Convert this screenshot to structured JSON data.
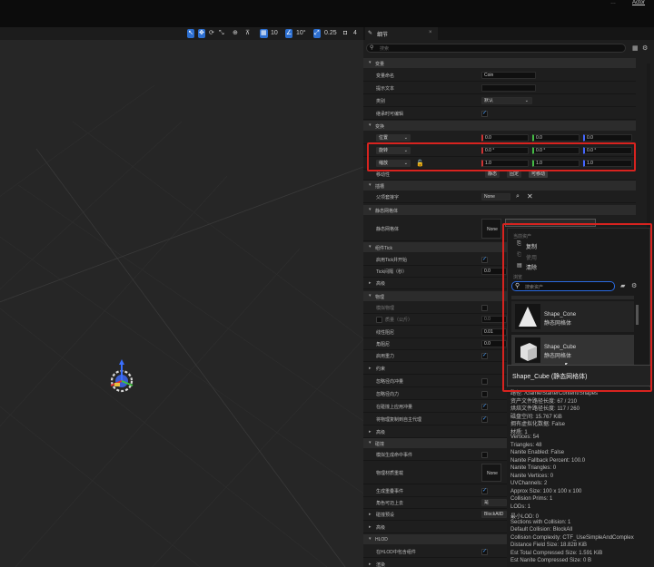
{
  "topbar": {
    "right_text1": "…",
    "right_text2": "Actor"
  },
  "viewport": {
    "toolbar": {
      "grid": "10",
      "angle": "10°",
      "scale": "0.25",
      "cams": "4"
    }
  },
  "panel": {
    "tab": "细节",
    "search_placeholder": "搜索",
    "sections": {
      "variable": "变量",
      "transform": "变换",
      "socket": "插槽",
      "static_mesh": "静态网格体",
      "component_tick": "组件Tick",
      "advanced": "高级",
      "physics": "物理",
      "constraints": "约束",
      "collision": "碰撞",
      "hlod": "HLOD",
      "rendering": "渲染"
    },
    "rows": {
      "var_name": {
        "label": "变量命名",
        "value": "Coin"
      },
      "tooltip": {
        "label": "提示文本",
        "value": ""
      },
      "category": {
        "label": "类别",
        "value": "默认"
      },
      "editable": {
        "label": "继承时可编辑"
      },
      "location": {
        "label": "位置",
        "x": "0.0",
        "y": "0.0",
        "z": "0.0"
      },
      "rotation": {
        "label": "旋转",
        "x": "0.0 °",
        "y": "0.0 °",
        "z": "0.0 °"
      },
      "scale": {
        "label": "缩放",
        "x": "1.0",
        "y": "1.0",
        "z": "1.0"
      },
      "mobility": {
        "label": "移动性",
        "options": [
          "静态",
          "固定",
          "可移动"
        ]
      },
      "parent_socket": {
        "label": "父项套接字",
        "value": "None"
      },
      "static_mesh": {
        "label": "静态网格体",
        "value": "None"
      },
      "tick_start": {
        "label": "启用Tick并开始"
      },
      "tick_interval": {
        "label": "Tick间隔（秒）",
        "value": "0.0"
      },
      "simulate": {
        "label": "模拟物理"
      },
      "mass": {
        "label": "质量（公斤）",
        "value": "0.0"
      },
      "linear_damp": {
        "label": "线性阻尼",
        "value": "0.01"
      },
      "angular_damp": {
        "label": "角阻尼",
        "value": "0.0"
      },
      "gravity": {
        "label": "启用重力"
      },
      "ignore_radial_impulse": {
        "label": "忽略径向冲量"
      },
      "ignore_radial_force": {
        "label": "忽略径向力"
      },
      "apply_impulse": {
        "label": "在碰撞上应用冲量"
      },
      "replicate": {
        "label": "将物理复制到自主代理"
      },
      "overlap_events": {
        "label": "模拟生成命中事件"
      },
      "phys_material": {
        "label": "物理材质重载",
        "value": "None"
      },
      "gen_overlap": {
        "label": "生成重叠事件"
      },
      "char_step": {
        "label": "角色可迈上去",
        "value": "是"
      },
      "collision_preset": {
        "label": "碰撞预设",
        "value": "BlockAllD"
      },
      "hlod_include": {
        "label": "在HLOD中包含组件"
      }
    }
  },
  "popup": {
    "section_current": "当前资产",
    "copy": "复制",
    "use": "使用",
    "clear": "清除",
    "section_browse": "浏览",
    "search_placeholder": "搜索资产",
    "items": [
      {
        "name": "Shape_Cone",
        "type": "静态网格体"
      },
      {
        "name": "Shape_Cube",
        "type": "静态网格体"
      }
    ],
    "tooltip_title": "Shape_Cube (静态网格体)",
    "details": [
      "路径: /Game/StarterContent/Shapes",
      "资产文件路径长度: 67 / 210",
      "烘焙文件路径长度: 117 / 260",
      "磁盘空间: 15.767 KiB",
      "拥有虚拟化数据: False",
      "材质: 1",
      "Vertices: 54",
      "Triangles: 48",
      "Nanite Enabled: False",
      "Nanite Fallback Percent: 100.0",
      "Nanite Triangles: 0",
      "Nanite Vertices: 0",
      "UVChannels: 2",
      "Approx Size: 100 x 100 x 100",
      "Collision Prims: 1",
      "LODs: 1",
      "最小LOD: 0",
      "Sections with Collision: 1",
      "Default Collision: BlockAll",
      "Collision Complexity: CTF_UseSimpleAndComplex",
      "Distance Field Size: 18.828 KiB",
      "Est Total Compressed Size: 1.591 KiB",
      "Est Nanite Compressed Size: 0 B"
    ]
  }
}
